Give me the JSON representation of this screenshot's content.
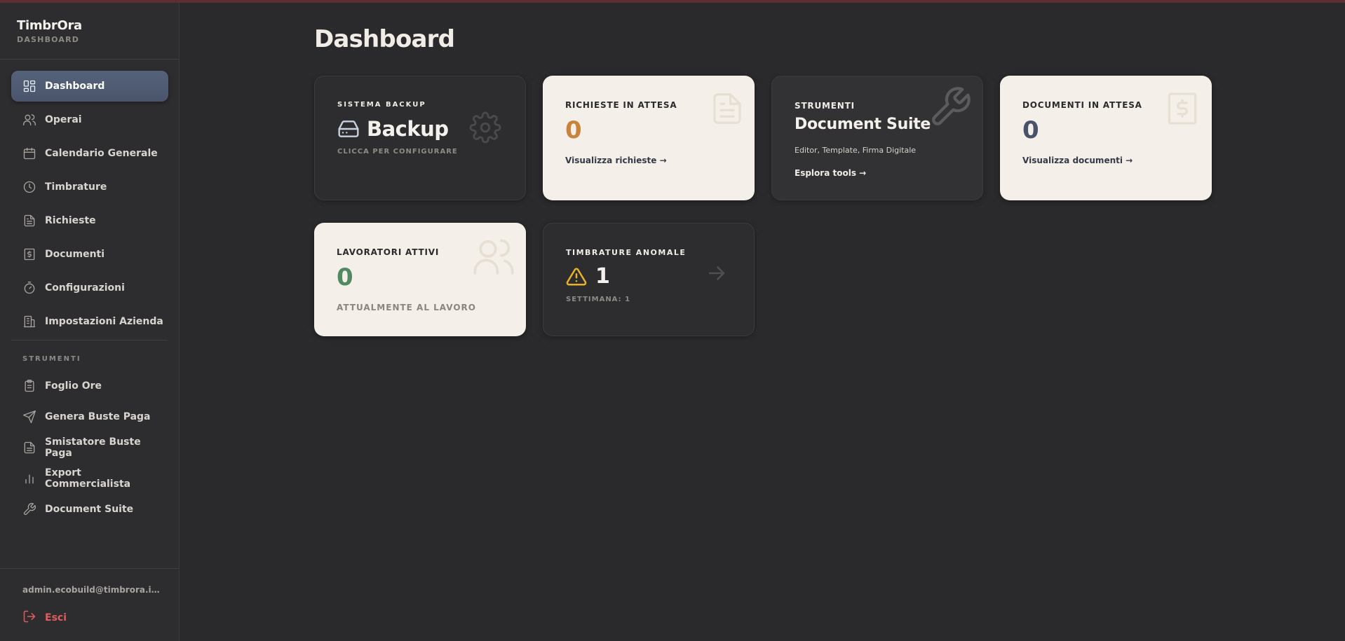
{
  "app": {
    "name": "TimbrOra",
    "subtitle": "DASHBOARD"
  },
  "sidebar": {
    "items": [
      {
        "label": "Dashboard",
        "icon": "layout-grid-icon",
        "active": true
      },
      {
        "label": "Operai",
        "icon": "users-icon"
      },
      {
        "label": "Calendario Generale",
        "icon": "calendar-icon"
      },
      {
        "label": "Timbrature",
        "icon": "clock-icon"
      },
      {
        "label": "Richieste",
        "icon": "file-text-icon"
      },
      {
        "label": "Documenti",
        "icon": "receipt-icon"
      },
      {
        "label": "Configurazioni",
        "icon": "timer-icon"
      },
      {
        "label": "Impostazioni Azienda",
        "icon": "building-icon"
      }
    ],
    "tools_label": "STRUMENTI",
    "tools": [
      {
        "label": "Foglio Ore",
        "icon": "clipboard-icon"
      },
      {
        "label": "Genera Buste Paga",
        "icon": "send-icon"
      },
      {
        "label": "Smistatore Buste Paga",
        "icon": "file-text-icon"
      },
      {
        "label": "Export Commercialista",
        "icon": "bar-chart-icon"
      },
      {
        "label": "Document Suite",
        "icon": "wrench-icon"
      }
    ],
    "user_email": "admin.ecobuild@timbrora.internal",
    "logout_label": "Esci"
  },
  "main": {
    "title": "Dashboard",
    "cards": {
      "backup": {
        "label": "SISTEMA BACKUP",
        "title": "Backup",
        "sub": "CLICCA PER CONFIGURARE"
      },
      "requests": {
        "label": "RICHIESTE IN ATTESA",
        "value": "0",
        "link": "Visualizza richieste →"
      },
      "tools": {
        "label": "STRUMENTI",
        "title": "Document Suite",
        "desc": "Editor, Template, Firma Digitale",
        "link": "Esplora tools →"
      },
      "documents": {
        "label": "DOCUMENTI IN ATTESA",
        "value": "0",
        "link": "Visualizza documenti →"
      },
      "workers": {
        "label": "LAVORATORI ATTIVI",
        "value": "0",
        "sub": "ATTUALMENTE AL LAVORO"
      },
      "anomalies": {
        "label": "TIMBRATURE ANOMALE",
        "value": "1",
        "sub": "SETTIMANA: 1"
      }
    }
  },
  "colors": {
    "accent_orange": "#c9833a",
    "accent_slate": "#4a5269",
    "accent_green": "#4f8a63",
    "warning": "#e8b32a",
    "danger": "#e25c5c"
  }
}
